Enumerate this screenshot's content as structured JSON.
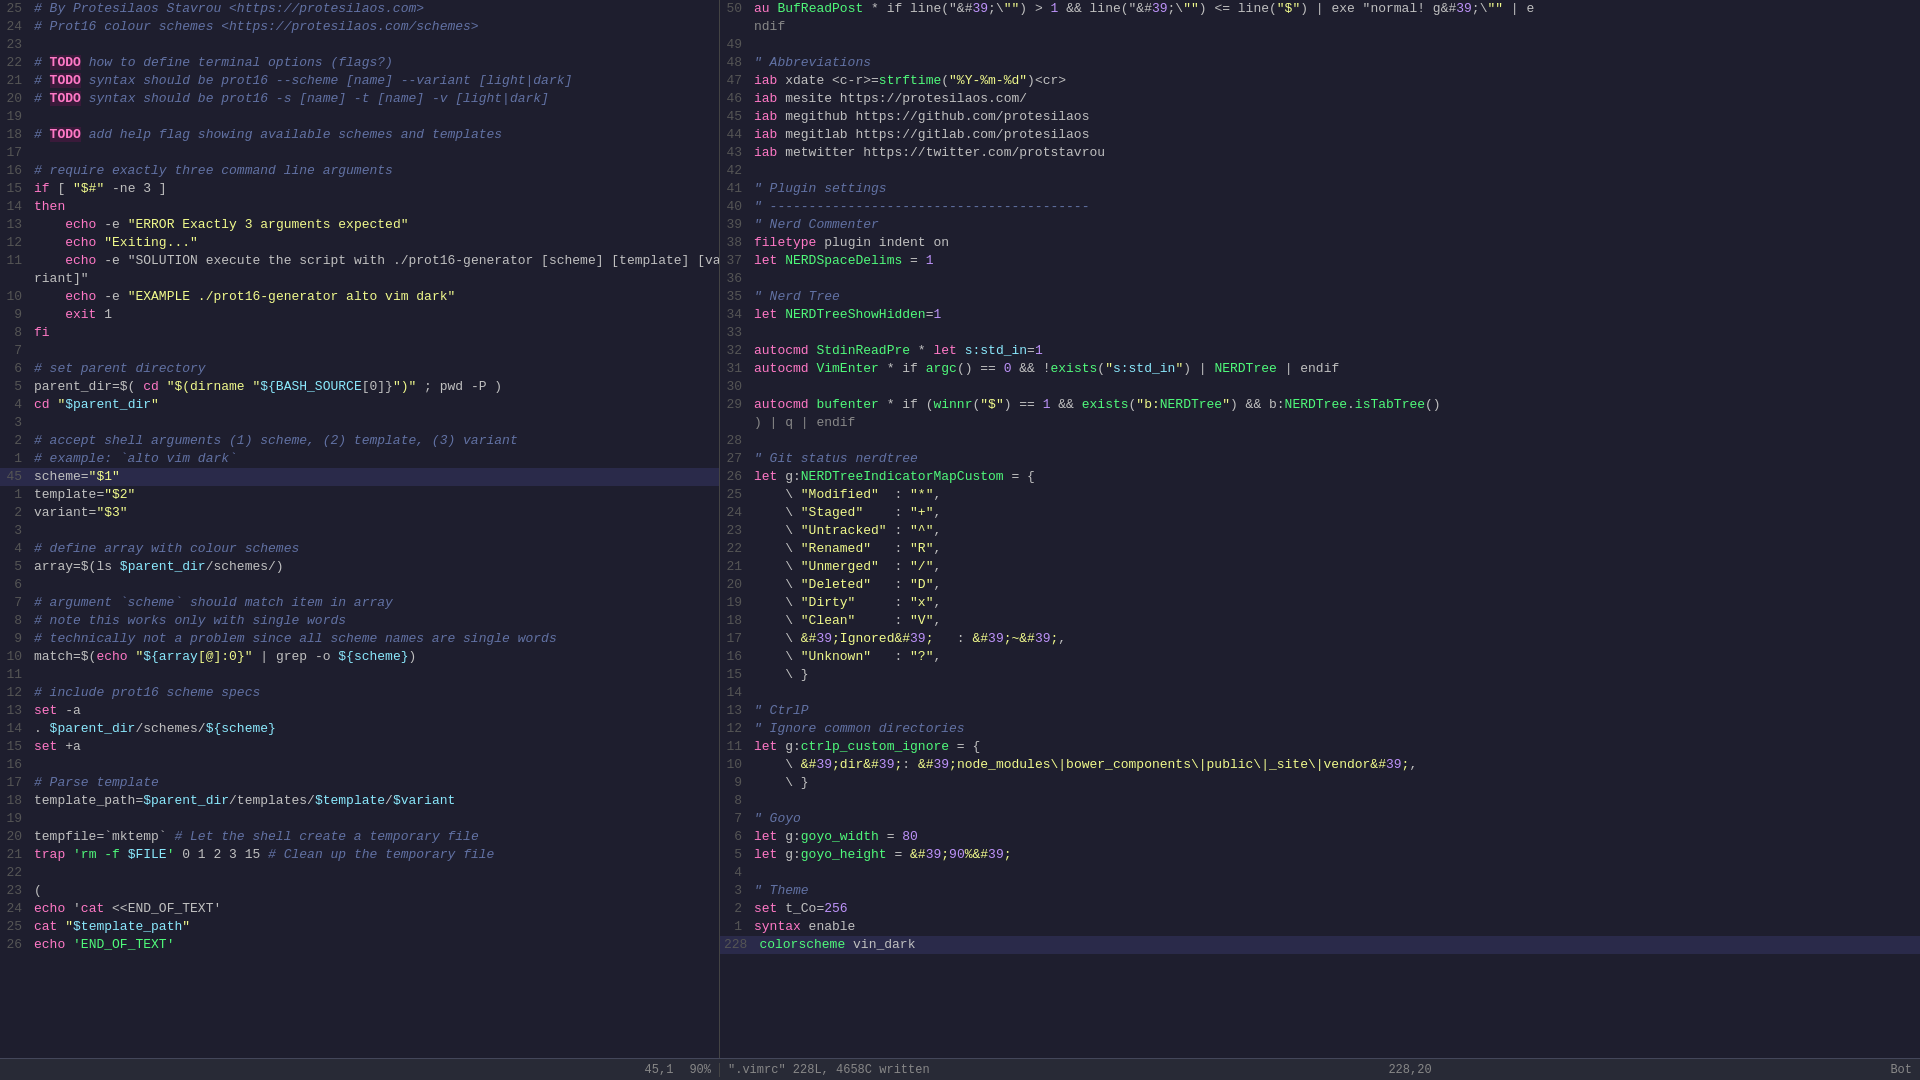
{
  "editor": {
    "left_pane": {
      "lines": [
        {
          "num": "25",
          "content": "# By Protesilaos Stavrou <https://protesilaos.com>",
          "type": "comment"
        },
        {
          "num": "24",
          "content": "# Prot16 colour schemes <https://protesilaos.com/schemes>",
          "type": "comment"
        },
        {
          "num": "23",
          "content": "",
          "type": "plain"
        },
        {
          "num": "22",
          "content": "# TODO how to define terminal options (flags?)",
          "type": "todo-comment"
        },
        {
          "num": "21",
          "content": "# TODO syntax should be prot16 --scheme [name] --variant [light|dark]",
          "type": "todo-comment"
        },
        {
          "num": "20",
          "content": "# TODO syntax should be prot16 -s [name] -t [name] -v [light|dark]",
          "type": "todo-comment"
        },
        {
          "num": "19",
          "content": "",
          "type": "plain"
        },
        {
          "num": "18",
          "content": "# TODO add help flag showing available schemes and templates",
          "type": "todo-comment"
        },
        {
          "num": "17",
          "content": "",
          "type": "plain"
        },
        {
          "num": "16",
          "content": "# require exactly three command line arguments",
          "type": "comment"
        },
        {
          "num": "15",
          "content": "if [ \"$#\" -ne 3 ]",
          "type": "code"
        },
        {
          "num": "14",
          "content": "then",
          "type": "keyword"
        },
        {
          "num": "13",
          "content": "    echo -e \"ERROR Exactly 3 arguments expected\"",
          "type": "echo"
        },
        {
          "num": "12",
          "content": "    echo \"Exiting...\"",
          "type": "echo"
        },
        {
          "num": "11",
          "content": "    echo -e \"SOLUTION execute the script with ./prot16-generator [scheme] [template] [va",
          "type": "echo"
        },
        {
          "num": "",
          "content": "riant]\"",
          "type": "continuation"
        },
        {
          "num": "10",
          "content": "    echo -e \"EXAMPLE ./prot16-generator alto vim dark\"",
          "type": "echo"
        },
        {
          "num": "9",
          "content": "    exit 1",
          "type": "code"
        },
        {
          "num": "8",
          "content": "fi",
          "type": "keyword"
        },
        {
          "num": "7",
          "content": "",
          "type": "plain"
        },
        {
          "num": "6",
          "content": "# set parent directory",
          "type": "comment"
        },
        {
          "num": "5",
          "content": "parent_dir=$( cd \"$(dirname \"${BASH_SOURCE[0]}\")\" ; pwd -P )",
          "type": "code"
        },
        {
          "num": "4",
          "content": "cd \"$parent_dir\"",
          "type": "code"
        },
        {
          "num": "3",
          "content": "",
          "type": "plain"
        },
        {
          "num": "2",
          "content": "# accept shell arguments (1) scheme, (2) template, (3) variant",
          "type": "comment"
        },
        {
          "num": "1",
          "content": "# example: `alto vim dark`",
          "type": "comment"
        },
        {
          "num": "45",
          "content": "scheme=\"$1\"",
          "type": "code",
          "highlighted": true
        },
        {
          "num": "1",
          "content": "template=\"$2\"",
          "type": "code"
        },
        {
          "num": "2",
          "content": "variant=\"$3\"",
          "type": "code"
        },
        {
          "num": "3",
          "content": "",
          "type": "plain"
        },
        {
          "num": "4",
          "content": "# define array with colour schemes",
          "type": "comment"
        },
        {
          "num": "5",
          "content": "array=$(ls $parent_dir/schemes/)",
          "type": "code"
        },
        {
          "num": "6",
          "content": "",
          "type": "plain"
        },
        {
          "num": "7",
          "content": "# argument `scheme` should match item in array",
          "type": "comment"
        },
        {
          "num": "8",
          "content": "# note this works only with single words",
          "type": "comment"
        },
        {
          "num": "9",
          "content": "# technically not a problem since all scheme names are single words",
          "type": "comment"
        },
        {
          "num": "10",
          "content": "match=$(echo \"${array[@]:0}\" | grep -o ${scheme})",
          "type": "code"
        },
        {
          "num": "11",
          "content": "",
          "type": "plain"
        },
        {
          "num": "12",
          "content": "# include prot16 scheme specs",
          "type": "comment"
        },
        {
          "num": "13",
          "content": "set -a",
          "type": "code"
        },
        {
          "num": "14",
          "content": ". $parent_dir/schemes/${scheme}",
          "type": "code"
        },
        {
          "num": "15",
          "content": "set +a",
          "type": "code"
        },
        {
          "num": "16",
          "content": "",
          "type": "plain"
        },
        {
          "num": "17",
          "content": "# Parse template",
          "type": "comment"
        },
        {
          "num": "18",
          "content": "template_path=$parent_dir/templates/$template/$variant",
          "type": "code"
        },
        {
          "num": "19",
          "content": "",
          "type": "plain"
        },
        {
          "num": "20",
          "content": "tempfile=`mktemp` # Let the shell create a temporary file",
          "type": "code"
        },
        {
          "num": "21",
          "content": "trap 'rm -f $FILE' 0 1 2 3 15 # Clean up the temporary file",
          "type": "code"
        },
        {
          "num": "22",
          "content": "",
          "type": "plain"
        },
        {
          "num": "23",
          "content": "(",
          "type": "code"
        },
        {
          "num": "24",
          "content": "echo 'cat <<END_OF_TEXT'",
          "type": "echo"
        },
        {
          "num": "25",
          "content": "cat \"$template_path\"",
          "type": "code"
        },
        {
          "num": "26",
          "content": "echo 'END_OF_TEXT'",
          "type": "echo"
        }
      ],
      "status": "45,1",
      "percent": "90%"
    },
    "right_pane": {
      "lines": [
        {
          "num": "50",
          "content": "au BufReadPost * if line(\"'\\\"\") > 1 && line(\"'\\\"\") <= line(\"$\") | exe \"normal! g'\\\"\" | e",
          "type": "code"
        },
        {
          "num": "",
          "content": "ndif",
          "type": "continuation"
        },
        {
          "num": "49",
          "content": "",
          "type": "plain"
        },
        {
          "num": "48",
          "content": "\" Abbreviations",
          "type": "section"
        },
        {
          "num": "47",
          "content": "iab xdate <c-r>=strftime(\"%Y-%m-%d\")<cr>",
          "type": "code"
        },
        {
          "num": "46",
          "content": "iab mesite https://protesilaos.com/",
          "type": "code"
        },
        {
          "num": "45",
          "content": "iab megithub https://github.com/protesilaos",
          "type": "code"
        },
        {
          "num": "44",
          "content": "iab megitlab https://gitlab.com/protesilaos",
          "type": "code"
        },
        {
          "num": "43",
          "content": "iab metwitter https://twitter.com/protstavrou",
          "type": "code"
        },
        {
          "num": "42",
          "content": "",
          "type": "plain"
        },
        {
          "num": "41",
          "content": "\" Plugin settings",
          "type": "section"
        },
        {
          "num": "40",
          "content": "\" -----------------------------------------",
          "type": "section"
        },
        {
          "num": "39",
          "content": "\" Nerd Commenter",
          "type": "section"
        },
        {
          "num": "38",
          "content": "filetype plugin indent on",
          "type": "code"
        },
        {
          "num": "37",
          "content": "let NERDSpaceDelims = 1",
          "type": "code"
        },
        {
          "num": "36",
          "content": "",
          "type": "plain"
        },
        {
          "num": "35",
          "content": "\" Nerd Tree",
          "type": "section"
        },
        {
          "num": "34",
          "content": "let NERDTreeShowHidden=1",
          "type": "code"
        },
        {
          "num": "33",
          "content": "",
          "type": "plain"
        },
        {
          "num": "32",
          "content": "autocmd StdinReadPre * let s:std_in=1",
          "type": "code"
        },
        {
          "num": "31",
          "content": "autocmd VimEnter * if argc() == 0 && !exists(\"s:std_in\") | NERDTree | endif",
          "type": "code"
        },
        {
          "num": "30",
          "content": "",
          "type": "plain"
        },
        {
          "num": "29",
          "content": "autocmd bufenter * if (winnr(\"$\") == 1 && exists(\"b:NERDTree\") && b:NERDTree.isTabTree()",
          "type": "code"
        },
        {
          "num": "",
          "content": ") | q | endif",
          "type": "continuation"
        },
        {
          "num": "28",
          "content": "",
          "type": "plain"
        },
        {
          "num": "27",
          "content": "\" Git status nerdtree",
          "type": "section"
        },
        {
          "num": "26",
          "content": "let g:NERDTreeIndicatorMapCustom = {",
          "type": "code"
        },
        {
          "num": "25",
          "content": "    \\ \"Modified\"  : \"*\",",
          "type": "code"
        },
        {
          "num": "24",
          "content": "    \\ \"Staged\"    : \"+\",",
          "type": "code"
        },
        {
          "num": "23",
          "content": "    \\ \"Untracked\" : \"^\",",
          "type": "code"
        },
        {
          "num": "22",
          "content": "    \\ \"Renamed\"   : \"R\",",
          "type": "code"
        },
        {
          "num": "21",
          "content": "    \\ \"Unmerged\"  : \"/\",",
          "type": "code"
        },
        {
          "num": "20",
          "content": "    \\ \"Deleted\"   : \"D\",",
          "type": "code"
        },
        {
          "num": "19",
          "content": "    \\ \"Dirty\"     : \"x\",",
          "type": "code"
        },
        {
          "num": "18",
          "content": "    \\ \"Clean\"     : \"V\",",
          "type": "code"
        },
        {
          "num": "17",
          "content": "    \\ 'Ignored'   : '~',",
          "type": "code"
        },
        {
          "num": "16",
          "content": "    \\ \"Unknown\"   : \"?\",",
          "type": "code"
        },
        {
          "num": "15",
          "content": "    \\ }",
          "type": "code"
        },
        {
          "num": "14",
          "content": "",
          "type": "plain"
        },
        {
          "num": "13",
          "content": "\" CtrlP",
          "type": "section"
        },
        {
          "num": "12",
          "content": "\" Ignore common directories",
          "type": "section"
        },
        {
          "num": "11",
          "content": "let g:ctrlp_custom_ignore = {",
          "type": "code"
        },
        {
          "num": "10",
          "content": "    \\ 'dir': 'node_modules\\|bower_components\\|public\\|_site\\|vendor',",
          "type": "code"
        },
        {
          "num": "9",
          "content": "    \\ }",
          "type": "code"
        },
        {
          "num": "8",
          "content": "",
          "type": "plain"
        },
        {
          "num": "7",
          "content": "\" Goyo",
          "type": "section"
        },
        {
          "num": "6",
          "content": "let g:goyo_width = 80",
          "type": "code"
        },
        {
          "num": "5",
          "content": "let g:goyo_height = '90%'",
          "type": "code"
        },
        {
          "num": "4",
          "content": "",
          "type": "plain"
        },
        {
          "num": "3",
          "content": "\" Theme",
          "type": "section"
        },
        {
          "num": "2",
          "content": "set t_Co=256",
          "type": "code"
        },
        {
          "num": "1",
          "content": "syntax enable",
          "type": "code"
        },
        {
          "num": "228",
          "content": "colorscheme vin_dark",
          "type": "code",
          "highlighted": true
        }
      ],
      "status": "228,20",
      "mode": "Bot"
    }
  },
  "statusbar": {
    "bottom_left_pos": "45,1",
    "bottom_left_pct": "90%",
    "bottom_right_file": "\".vimrc\" 228L, 4658C written",
    "bottom_right_pos": "228,20",
    "bottom_right_mode": "Bot"
  }
}
